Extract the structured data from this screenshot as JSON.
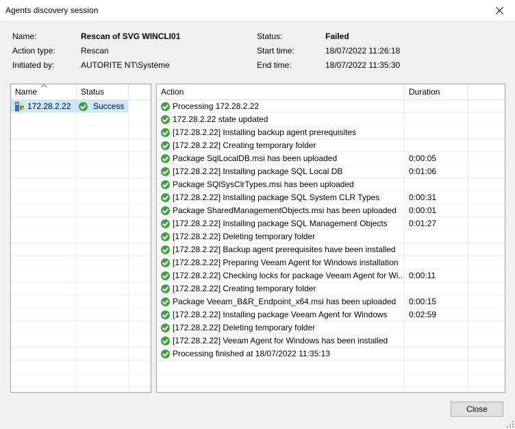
{
  "window": {
    "title": "Agents discovery session"
  },
  "info": {
    "name_label": "Name:",
    "name_value": "Rescan of SVG WINCLI01",
    "action_type_label": "Action type:",
    "action_type_value": "Rescan",
    "initiated_by_label": "Initiated by:",
    "initiated_by_value": "AUTORITE NT\\Système",
    "status_label": "Status:",
    "status_value": "Failed",
    "start_time_label": "Start time:",
    "start_time_value": "18/07/2022 11:26:18",
    "end_time_label": "End time:",
    "end_time_value": "18/07/2022 11:35:30"
  },
  "hosts_table": {
    "columns": {
      "name": "Name",
      "status": "Status"
    },
    "rows": [
      {
        "name": "172.28.2.22",
        "status": "Success"
      }
    ]
  },
  "actions_table": {
    "columns": {
      "action": "Action",
      "duration": "Duration"
    },
    "rows": [
      {
        "action": "Processing 172.28.2.22",
        "duration": ""
      },
      {
        "action": "172.28.2.22 state updated",
        "duration": ""
      },
      {
        "action": "[172.28.2.22] Installing backup agent prerequisites",
        "duration": ""
      },
      {
        "action": "[172.28.2.22] Creating temporary folder",
        "duration": ""
      },
      {
        "action": "Package SqlLocalDB.msi has been uploaded",
        "duration": "0:00:05"
      },
      {
        "action": "[172.28.2.22] Installing package SQL Local DB",
        "duration": "0:01:06"
      },
      {
        "action": "Package SQlSysClrTypes.msi has been uploaded",
        "duration": ""
      },
      {
        "action": "[172.28.2.22] Installing package SQL System CLR Types",
        "duration": "0:00:31"
      },
      {
        "action": "Package SharedManagementObjects.msi has been uploaded",
        "duration": "0:00:01"
      },
      {
        "action": "[172.28.2.22] Installing package SQL Management Objects",
        "duration": "0:01:27"
      },
      {
        "action": "[172.28.2.22] Deleting temporary folder",
        "duration": ""
      },
      {
        "action": "[172.28.2.22] Backup agent prerequisites have been installed",
        "duration": ""
      },
      {
        "action": "[172.28.2.22] Preparing Veeam Agent for Windows installation",
        "duration": ""
      },
      {
        "action": "[172.28.2.22] Checking locks for package Veeam Agent for Wi...",
        "duration": "0:00:11"
      },
      {
        "action": "[172.28.2.22] Creating temporary folder",
        "duration": ""
      },
      {
        "action": "Package Veeam_B&R_Endpoint_x64.msi has been uploaded",
        "duration": "0:00:15"
      },
      {
        "action": "[172.28.2.22] Installing package Veeam Agent for Windows",
        "duration": "0:02:59"
      },
      {
        "action": "[172.28.2.22] Deleting temporary folder",
        "duration": ""
      },
      {
        "action": "[172.28.2.22] Veeam Agent for Windows has been installed",
        "duration": ""
      },
      {
        "action": "Processing finished at 18/07/2022 11:35:13",
        "duration": ""
      }
    ]
  },
  "buttons": {
    "close": "Close"
  },
  "colors": {
    "success": "#3ea23e",
    "selection": "#cce8ff"
  }
}
